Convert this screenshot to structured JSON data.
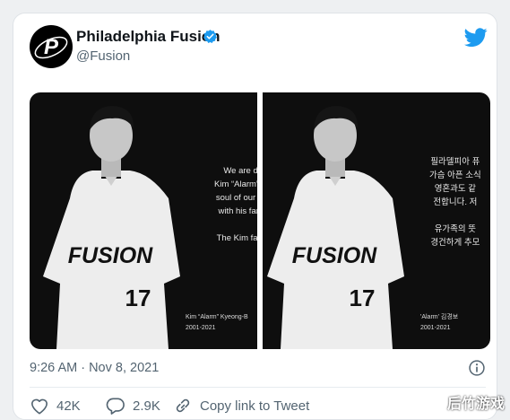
{
  "tweet": {
    "author_name": "Philadelphia Fusion",
    "author_handle": "@Fusion",
    "timestamp": "9:26 AM · Nov 8, 2021",
    "likes": "42K",
    "replies": "2.9K",
    "copy_link_label": "Copy link to Tweet"
  },
  "image_left": {
    "lines": [
      "We are d",
      "Kim “Alarm” K",
      "soul of our or",
      "with his fam",
      "",
      "The Kim fam"
    ],
    "player_name": "Kim “Alarm” Kyeong-B",
    "years": "2001-2021"
  },
  "image_right": {
    "lines": [
      "필라델피아 퓨",
      "가슴 아픈 소식",
      "영혼과도 같",
      "전합니다. 저",
      "",
      "유가족의 뜻",
      "경건하게 추모"
    ],
    "player_name": "'Alarm' 김경보",
    "years": "2001-2021"
  },
  "jersey": {
    "word": "FUSION",
    "number": "17"
  },
  "watermark": "后竹游戏",
  "icons": {
    "bird": "twitter-bird-icon",
    "verified": "verified-badge-icon",
    "info": "info-icon",
    "like": "heart-icon",
    "reply": "reply-icon",
    "link": "link-icon"
  },
  "colors": {
    "twitter_blue": "#1d9bf0",
    "text": "#0f1419",
    "secondary": "#536471"
  }
}
